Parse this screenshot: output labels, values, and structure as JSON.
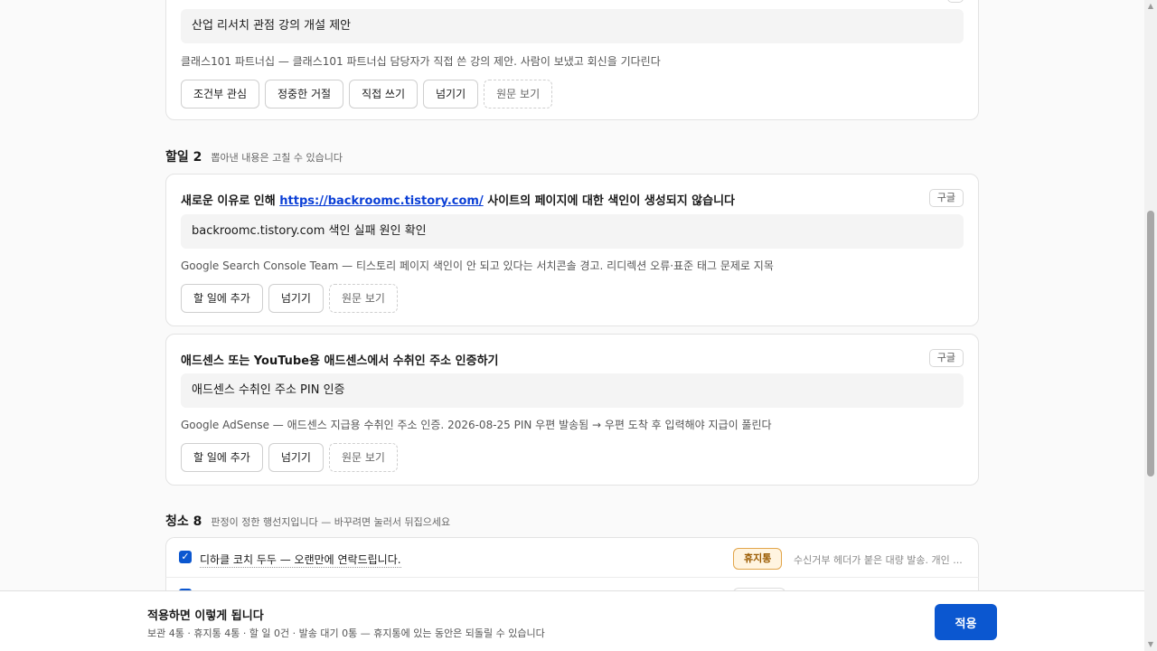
{
  "top_card": {
    "edit_value": "산업 리서치 관점 강의 개설 제안",
    "meta": "클래스101 파트너십 — 클래스101 파트너십 담당자가 직접 쓴 강의 제안. 사람이 보냈고 회신을 기다린다",
    "buttons": [
      "조건부 관심",
      "정중한 거절",
      "직접 쓰기",
      "넘기기",
      "원문 보기"
    ]
  },
  "todo_section": {
    "title": "할일 2",
    "desc": "뽑아낸 내용은 고칠 수 있습니다"
  },
  "todo_cards": [
    {
      "title_prefix": "새로운 이유로 인해 ",
      "title_link": "https://backroomc.tistory.com/",
      "title_suffix": " 사이트의 페이지에 대한 색인이 생성되지 않습니다",
      "source": "구글",
      "edit_value": "backroomc.tistory.com 색인 실패 원인 확인",
      "meta": "Google Search Console Team — 티스토리 페이지 색인이 안 되고 있다는 서치콘솔 경고. 리디렉션 오류·표준 태그 문제로 지목",
      "buttons": [
        "할 일에 추가",
        "넘기기",
        "원문 보기"
      ]
    },
    {
      "title": "애드센스 또는 YouTube용 애드센스에서 수취인 주소 인증하기",
      "source": "구글",
      "edit_value": "애드센스 수취인 주소 PIN 인증",
      "meta": "Google AdSense — 애드센스 지급용 수취인 주소 인증. 2026-08-25 PIN 우편 발송됨 → 우편 도착 후 입력해야 지급이 풀린다",
      "buttons": [
        "할 일에 추가",
        "넘기기",
        "원문 보기"
      ]
    }
  ],
  "clean_section": {
    "title": "청소 8",
    "desc": "판정이 정한 행선지입니다 — 바꾸려면 눌러서 뒤집으세요"
  },
  "clean_rows": [
    {
      "checked": true,
      "subject": "디하클 코치 두두 — 오랜만에 연락드립니다.",
      "badge": "휴지통",
      "reason": "수신거부 헤더가 붙은 대량 발송. 개인 ..."
    }
  ],
  "footer": {
    "title": "적용하면 이렇게 됩니다",
    "summary": "보관 4통 · 휴지통 4통 · 할 일 0건 · 발송 대기 0통 — 휴지통에 있는 동안은 되돌릴 수 있습니다",
    "apply_label": "적용"
  },
  "colors": {
    "primary": "#0b57d0",
    "trash_badge_bg": "#fff4e0",
    "trash_badge_border": "#e2a54a",
    "link": "#0b3fd6"
  }
}
